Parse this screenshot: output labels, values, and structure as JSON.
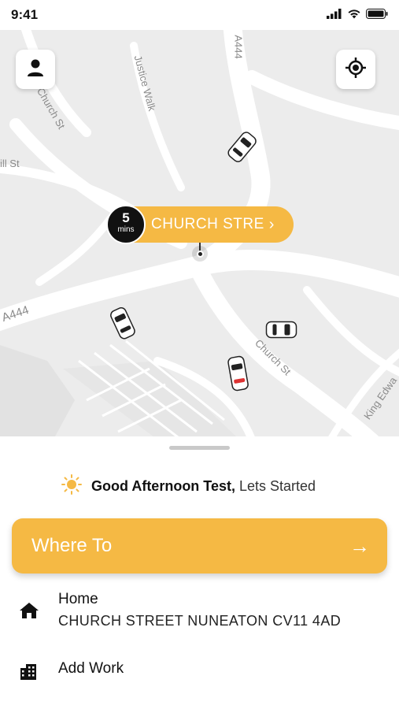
{
  "status_bar": {
    "time": "9:41",
    "icons": [
      "signal-icon",
      "wifi-icon",
      "battery-icon"
    ]
  },
  "map": {
    "street_labels": [
      "Church St",
      "Justice Walk",
      "A444",
      "ill St",
      "A444",
      "Church St",
      "King Edwa"
    ],
    "profile_button_icon": "person-icon",
    "locate_button_icon": "crosshair-icon",
    "pickup": {
      "eta_value": "5",
      "eta_unit": "mins",
      "location": "CHURCH STRE",
      "chevron": "›"
    }
  },
  "sheet": {
    "greeting": {
      "bold": "Good Afternoon Test,",
      "light": " Lets Started",
      "icon": "sun-icon"
    },
    "where_to": {
      "label": "Where To",
      "arrow": "→"
    },
    "places": [
      {
        "title": "Home",
        "subtitle": "CHURCH STREET NUNEATON CV11 4AD",
        "icon": "home-icon"
      },
      {
        "title": "Add Work",
        "icon": "work-building-icon"
      }
    ]
  },
  "colors": {
    "accent": "#f5b944",
    "map_bg": "#ececec",
    "road": "#ffffff"
  }
}
